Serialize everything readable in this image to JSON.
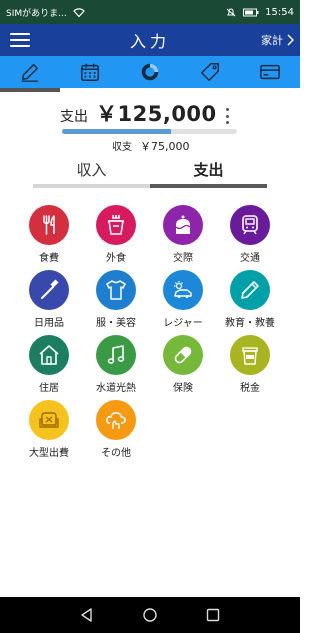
{
  "status_bar": {
    "carrier": "SIMがありま...",
    "time": "15:54"
  },
  "app_bar": {
    "title": "入力",
    "book_label": "家計",
    "menu_icon": "hamburger-icon",
    "chevron_icon": "chevron-right-icon"
  },
  "icon_tabs": [
    {
      "name": "pencil-icon",
      "active": true
    },
    {
      "name": "calendar-icon",
      "active": false
    },
    {
      "name": "donut-chart-icon",
      "active": false
    },
    {
      "name": "tag-icon",
      "active": false
    },
    {
      "name": "card-icon",
      "active": false
    }
  ],
  "summary": {
    "amount_label": "支出",
    "amount_value": "￥125,000",
    "progress": 0.62,
    "balance_label": "収支",
    "balance_value": "￥75,000"
  },
  "type_tabs": {
    "income": "収入",
    "expense": "支出",
    "active": "expense"
  },
  "categories": [
    {
      "label": "食費",
      "icon": "fork-knife-icon",
      "color": "#d32f3f"
    },
    {
      "label": "外食",
      "icon": "takeout-icon",
      "color": "#d81b60"
    },
    {
      "label": "交際",
      "icon": "cake-icon",
      "color": "#8e24aa"
    },
    {
      "label": "交通",
      "icon": "train-icon",
      "color": "#6a1b9a"
    },
    {
      "label": "日用品",
      "icon": "toothbrush-icon",
      "color": "#3949ab"
    },
    {
      "label": "服・美容",
      "icon": "shirt-icon",
      "color": "#1e7fd1"
    },
    {
      "label": "レジャー",
      "icon": "car-sun-icon",
      "color": "#1e88d8"
    },
    {
      "label": "教育・教養",
      "icon": "pencil-icon",
      "color": "#00a0a8"
    },
    {
      "label": "住居",
      "icon": "house-icon",
      "color": "#1b7e62"
    },
    {
      "label": "水道光熱",
      "icon": "music-note-icon",
      "color": "#3a9a45"
    },
    {
      "label": "保険",
      "icon": "pill-icon",
      "color": "#76b83a"
    },
    {
      "label": "税金",
      "icon": "coffee-cup-icon",
      "color": "#a8b420"
    },
    {
      "label": "大型出費",
      "icon": "sofa-icon",
      "color": "#f6c21e"
    },
    {
      "label": "その他",
      "icon": "cloud-hand-icon",
      "color": "#f59a12"
    }
  ],
  "colors": {
    "status_bar": "#1a4a35",
    "app_bar": "#19409a",
    "icon_bar": "#2196f3",
    "progress_fill": "#5b9bd5"
  }
}
